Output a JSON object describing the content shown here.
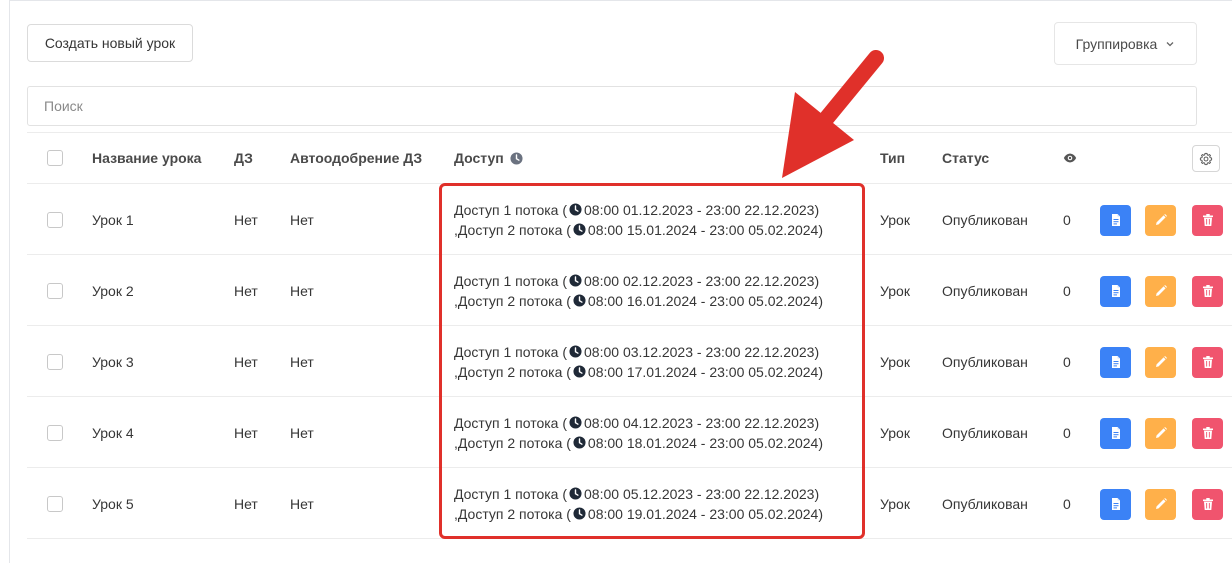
{
  "toolbar": {
    "create_label": "Создать новый урок",
    "grouping_label": "Группировка"
  },
  "search": {
    "placeholder": "Поиск"
  },
  "columns": {
    "name": "Название урока",
    "hw": "ДЗ",
    "auto": "Автоодобрение ДЗ",
    "access": "Доступ",
    "type": "Тип",
    "status": "Статус"
  },
  "rows": [
    {
      "name": "Урок 1",
      "hw": "Нет",
      "auto": "Нет",
      "access1_prefix": "Доступ 1 потока (",
      "access1_range": "08:00 01.12.2023 - 23:00 22.12.2023)",
      "access2_prefix": ",Доступ 2 потока (",
      "access2_range": "08:00 15.01.2024 - 23:00 05.02.2024)",
      "type": "Урок",
      "status": "Опубликован",
      "views": "0"
    },
    {
      "name": "Урок 2",
      "hw": "Нет",
      "auto": "Нет",
      "access1_prefix": "Доступ 1 потока (",
      "access1_range": "08:00 02.12.2023 - 23:00 22.12.2023)",
      "access2_prefix": ",Доступ 2 потока (",
      "access2_range": "08:00 16.01.2024 - 23:00 05.02.2024)",
      "type": "Урок",
      "status": "Опубликован",
      "views": "0"
    },
    {
      "name": "Урок 3",
      "hw": "Нет",
      "auto": "Нет",
      "access1_prefix": "Доступ 1 потока (",
      "access1_range": "08:00 03.12.2023 - 23:00 22.12.2023)",
      "access2_prefix": ",Доступ 2 потока (",
      "access2_range": "08:00 17.01.2024 - 23:00 05.02.2024)",
      "type": "Урок",
      "status": "Опубликован",
      "views": "0"
    },
    {
      "name": "Урок 4",
      "hw": "Нет",
      "auto": "Нет",
      "access1_prefix": "Доступ 1 потока (",
      "access1_range": "08:00 04.12.2023 - 23:00 22.12.2023)",
      "access2_prefix": ",Доступ 2 потока (",
      "access2_range": "08:00 18.01.2024 - 23:00 05.02.2024)",
      "type": "Урок",
      "status": "Опубликован",
      "views": "0"
    },
    {
      "name": "Урок 5",
      "hw": "Нет",
      "auto": "Нет",
      "access1_prefix": "Доступ 1 потока (",
      "access1_range": "08:00 05.12.2023 - 23:00 22.12.2023)",
      "access2_prefix": ",Доступ 2 потока (",
      "access2_range": "08:00 19.01.2024 - 23:00 05.02.2024)",
      "type": "Урок",
      "status": "Опубликован",
      "views": "0"
    }
  ],
  "colors": {
    "edit_doc": "#3b82f6",
    "edit_pencil": "#ffb04a",
    "delete": "#f0546e",
    "annotation": "#e0302a"
  },
  "icons": [
    "clock-icon",
    "eye-icon",
    "gear-icon",
    "document-icon",
    "pencil-icon",
    "trash-icon",
    "chevron-down-icon"
  ]
}
